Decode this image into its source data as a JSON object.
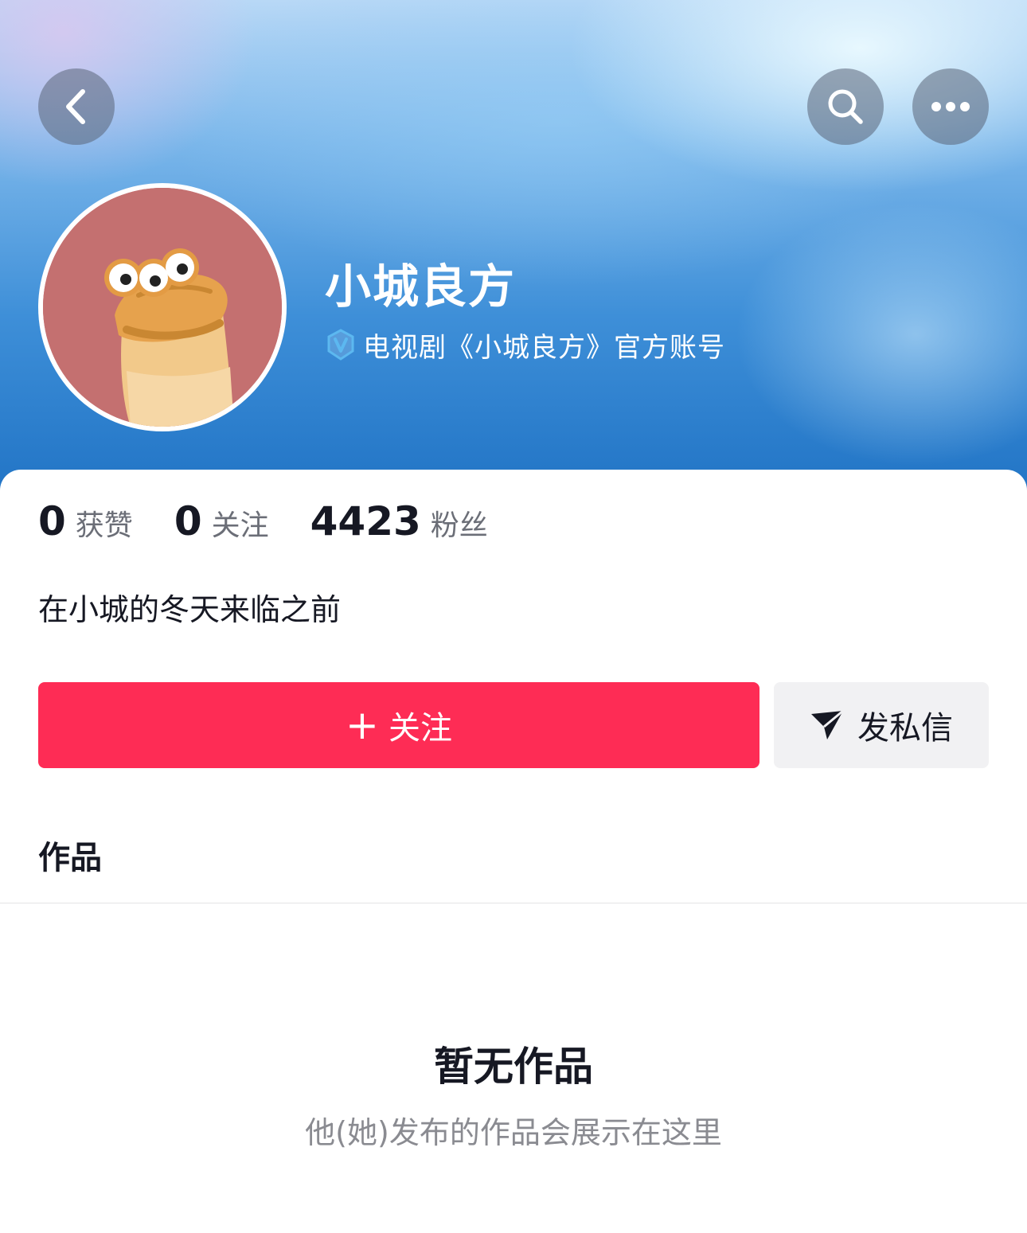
{
  "header": {
    "back_icon": "chevron-left-icon",
    "search_icon": "search-icon",
    "more_icon": "more-dots-icon"
  },
  "profile": {
    "name": "小城良方",
    "verify_icon": "verified-v-icon",
    "verify_color": "#5cb8f0",
    "verify_text": "电视剧《小城良方》官方账号",
    "avatar": "cartoon-character-avatar"
  },
  "stats": [
    {
      "value": "0",
      "label": "获赞"
    },
    {
      "value": "0",
      "label": "关注"
    },
    {
      "value": "4423",
      "label": "粉丝"
    }
  ],
  "bio": "在小城的冬天来临之前",
  "actions": {
    "follow_icon": "+",
    "follow_label": "关注",
    "follow_color": "#fe2c55",
    "message_icon": "send-arrow-icon",
    "message_label": "发私信"
  },
  "tabs": {
    "works_label": "作品"
  },
  "empty_state": {
    "title": "暂无作品",
    "subtitle": "他(她)发布的作品会展示在这里"
  }
}
